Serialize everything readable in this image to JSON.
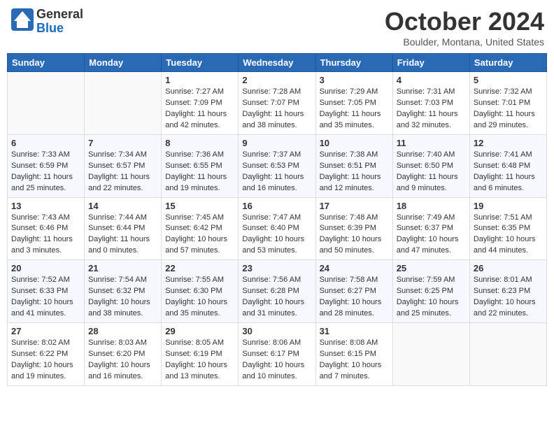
{
  "header": {
    "logo_general": "General",
    "logo_blue": "Blue",
    "month": "October 2024",
    "location": "Boulder, Montana, United States"
  },
  "days_of_week": [
    "Sunday",
    "Monday",
    "Tuesday",
    "Wednesday",
    "Thursday",
    "Friday",
    "Saturday"
  ],
  "weeks": [
    [
      {
        "day": "",
        "sunrise": "",
        "sunset": "",
        "daylight": ""
      },
      {
        "day": "",
        "sunrise": "",
        "sunset": "",
        "daylight": ""
      },
      {
        "day": "1",
        "sunrise": "Sunrise: 7:27 AM",
        "sunset": "Sunset: 7:09 PM",
        "daylight": "Daylight: 11 hours and 42 minutes."
      },
      {
        "day": "2",
        "sunrise": "Sunrise: 7:28 AM",
        "sunset": "Sunset: 7:07 PM",
        "daylight": "Daylight: 11 hours and 38 minutes."
      },
      {
        "day": "3",
        "sunrise": "Sunrise: 7:29 AM",
        "sunset": "Sunset: 7:05 PM",
        "daylight": "Daylight: 11 hours and 35 minutes."
      },
      {
        "day": "4",
        "sunrise": "Sunrise: 7:31 AM",
        "sunset": "Sunset: 7:03 PM",
        "daylight": "Daylight: 11 hours and 32 minutes."
      },
      {
        "day": "5",
        "sunrise": "Sunrise: 7:32 AM",
        "sunset": "Sunset: 7:01 PM",
        "daylight": "Daylight: 11 hours and 29 minutes."
      }
    ],
    [
      {
        "day": "6",
        "sunrise": "Sunrise: 7:33 AM",
        "sunset": "Sunset: 6:59 PM",
        "daylight": "Daylight: 11 hours and 25 minutes."
      },
      {
        "day": "7",
        "sunrise": "Sunrise: 7:34 AM",
        "sunset": "Sunset: 6:57 PM",
        "daylight": "Daylight: 11 hours and 22 minutes."
      },
      {
        "day": "8",
        "sunrise": "Sunrise: 7:36 AM",
        "sunset": "Sunset: 6:55 PM",
        "daylight": "Daylight: 11 hours and 19 minutes."
      },
      {
        "day": "9",
        "sunrise": "Sunrise: 7:37 AM",
        "sunset": "Sunset: 6:53 PM",
        "daylight": "Daylight: 11 hours and 16 minutes."
      },
      {
        "day": "10",
        "sunrise": "Sunrise: 7:38 AM",
        "sunset": "Sunset: 6:51 PM",
        "daylight": "Daylight: 11 hours and 12 minutes."
      },
      {
        "day": "11",
        "sunrise": "Sunrise: 7:40 AM",
        "sunset": "Sunset: 6:50 PM",
        "daylight": "Daylight: 11 hours and 9 minutes."
      },
      {
        "day": "12",
        "sunrise": "Sunrise: 7:41 AM",
        "sunset": "Sunset: 6:48 PM",
        "daylight": "Daylight: 11 hours and 6 minutes."
      }
    ],
    [
      {
        "day": "13",
        "sunrise": "Sunrise: 7:43 AM",
        "sunset": "Sunset: 6:46 PM",
        "daylight": "Daylight: 11 hours and 3 minutes."
      },
      {
        "day": "14",
        "sunrise": "Sunrise: 7:44 AM",
        "sunset": "Sunset: 6:44 PM",
        "daylight": "Daylight: 11 hours and 0 minutes."
      },
      {
        "day": "15",
        "sunrise": "Sunrise: 7:45 AM",
        "sunset": "Sunset: 6:42 PM",
        "daylight": "Daylight: 10 hours and 57 minutes."
      },
      {
        "day": "16",
        "sunrise": "Sunrise: 7:47 AM",
        "sunset": "Sunset: 6:40 PM",
        "daylight": "Daylight: 10 hours and 53 minutes."
      },
      {
        "day": "17",
        "sunrise": "Sunrise: 7:48 AM",
        "sunset": "Sunset: 6:39 PM",
        "daylight": "Daylight: 10 hours and 50 minutes."
      },
      {
        "day": "18",
        "sunrise": "Sunrise: 7:49 AM",
        "sunset": "Sunset: 6:37 PM",
        "daylight": "Daylight: 10 hours and 47 minutes."
      },
      {
        "day": "19",
        "sunrise": "Sunrise: 7:51 AM",
        "sunset": "Sunset: 6:35 PM",
        "daylight": "Daylight: 10 hours and 44 minutes."
      }
    ],
    [
      {
        "day": "20",
        "sunrise": "Sunrise: 7:52 AM",
        "sunset": "Sunset: 6:33 PM",
        "daylight": "Daylight: 10 hours and 41 minutes."
      },
      {
        "day": "21",
        "sunrise": "Sunrise: 7:54 AM",
        "sunset": "Sunset: 6:32 PM",
        "daylight": "Daylight: 10 hours and 38 minutes."
      },
      {
        "day": "22",
        "sunrise": "Sunrise: 7:55 AM",
        "sunset": "Sunset: 6:30 PM",
        "daylight": "Daylight: 10 hours and 35 minutes."
      },
      {
        "day": "23",
        "sunrise": "Sunrise: 7:56 AM",
        "sunset": "Sunset: 6:28 PM",
        "daylight": "Daylight: 10 hours and 31 minutes."
      },
      {
        "day": "24",
        "sunrise": "Sunrise: 7:58 AM",
        "sunset": "Sunset: 6:27 PM",
        "daylight": "Daylight: 10 hours and 28 minutes."
      },
      {
        "day": "25",
        "sunrise": "Sunrise: 7:59 AM",
        "sunset": "Sunset: 6:25 PM",
        "daylight": "Daylight: 10 hours and 25 minutes."
      },
      {
        "day": "26",
        "sunrise": "Sunrise: 8:01 AM",
        "sunset": "Sunset: 6:23 PM",
        "daylight": "Daylight: 10 hours and 22 minutes."
      }
    ],
    [
      {
        "day": "27",
        "sunrise": "Sunrise: 8:02 AM",
        "sunset": "Sunset: 6:22 PM",
        "daylight": "Daylight: 10 hours and 19 minutes."
      },
      {
        "day": "28",
        "sunrise": "Sunrise: 8:03 AM",
        "sunset": "Sunset: 6:20 PM",
        "daylight": "Daylight: 10 hours and 16 minutes."
      },
      {
        "day": "29",
        "sunrise": "Sunrise: 8:05 AM",
        "sunset": "Sunset: 6:19 PM",
        "daylight": "Daylight: 10 hours and 13 minutes."
      },
      {
        "day": "30",
        "sunrise": "Sunrise: 8:06 AM",
        "sunset": "Sunset: 6:17 PM",
        "daylight": "Daylight: 10 hours and 10 minutes."
      },
      {
        "day": "31",
        "sunrise": "Sunrise: 8:08 AM",
        "sunset": "Sunset: 6:15 PM",
        "daylight": "Daylight: 10 hours and 7 minutes."
      },
      {
        "day": "",
        "sunrise": "",
        "sunset": "",
        "daylight": ""
      },
      {
        "day": "",
        "sunrise": "",
        "sunset": "",
        "daylight": ""
      }
    ]
  ]
}
